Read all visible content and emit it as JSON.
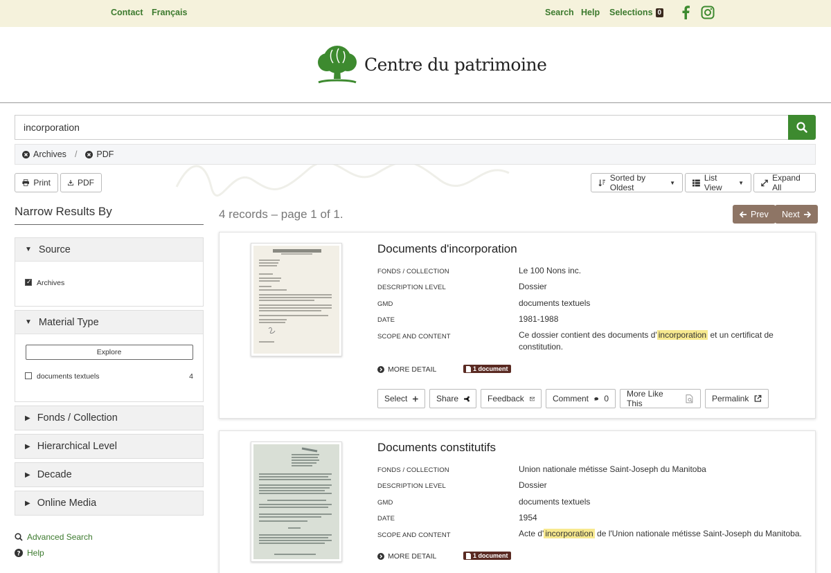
{
  "topbar": {
    "contact": "Contact",
    "language": "Français",
    "search": "Search",
    "help": "Help",
    "selections": "Selections",
    "selections_count": "0"
  },
  "logo": {
    "text": "Centre du patrimoine"
  },
  "search": {
    "value": "incorporation"
  },
  "filters": [
    {
      "label": "Archives"
    },
    {
      "label": "PDF"
    }
  ],
  "toolbar": {
    "print": "Print",
    "pdf": "PDF",
    "sort": "Sorted by Oldest",
    "view": "List View",
    "expand": "Expand All"
  },
  "sidebar": {
    "title": "Narrow Results By",
    "source": {
      "title": "Source",
      "items": [
        {
          "label": "Archives",
          "checked": true
        }
      ]
    },
    "material": {
      "title": "Material Type",
      "explore": "Explore",
      "items": [
        {
          "label": "documents textuels",
          "count": "4",
          "checked": false
        }
      ]
    },
    "collapsed": [
      {
        "title": "Fonds / Collection"
      },
      {
        "title": "Hierarchical Level"
      },
      {
        "title": "Decade"
      },
      {
        "title": "Online Media"
      }
    ],
    "advanced_search": "Advanced Search",
    "help": "Help"
  },
  "results": {
    "summary": "4 records – page 1 of 1.",
    "prev": "Prev",
    "next": "Next",
    "labels": {
      "fonds": "FONDS / COLLECTION",
      "level": "DESCRIPTION LEVEL",
      "gmd": "GMD",
      "date": "DATE",
      "scope": "SCOPE AND CONTENT",
      "more": "MORE DETAIL"
    },
    "records": [
      {
        "title": "Documents d'incorporation",
        "fonds": "Le 100 Nons inc.",
        "level": "Dossier",
        "gmd": "documents textuels",
        "date": "1981-1988",
        "scope_before": "Ce dossier contient des documents d'",
        "scope_hl": "incorporation",
        "scope_after": "et un certificat de constitution.",
        "badge": "1 document"
      },
      {
        "title": "Documents constitutifs",
        "fonds": "Union nationale métisse Saint-Joseph du Manitoba",
        "level": "Dossier",
        "gmd": "documents textuels",
        "date": "1954",
        "scope_before": "Acte d'",
        "scope_hl": "incorporation",
        "scope_after": "de l'Union nationale métisse Saint-Joseph du Manitoba.",
        "badge": "1 document"
      }
    ],
    "actions": {
      "select": "Select",
      "share": "Share",
      "feedback": "Feedback",
      "comment": "Comment",
      "comment_count": "0",
      "more_like": "More Like This",
      "permalink": "Permalink"
    }
  },
  "colors": {
    "accent_green": "#3d8a2f",
    "topbar_bg": "#f5f2dc",
    "pager_brown": "#8e7565",
    "badge_brown": "#5a2a22",
    "highlight": "#f7e98f"
  }
}
